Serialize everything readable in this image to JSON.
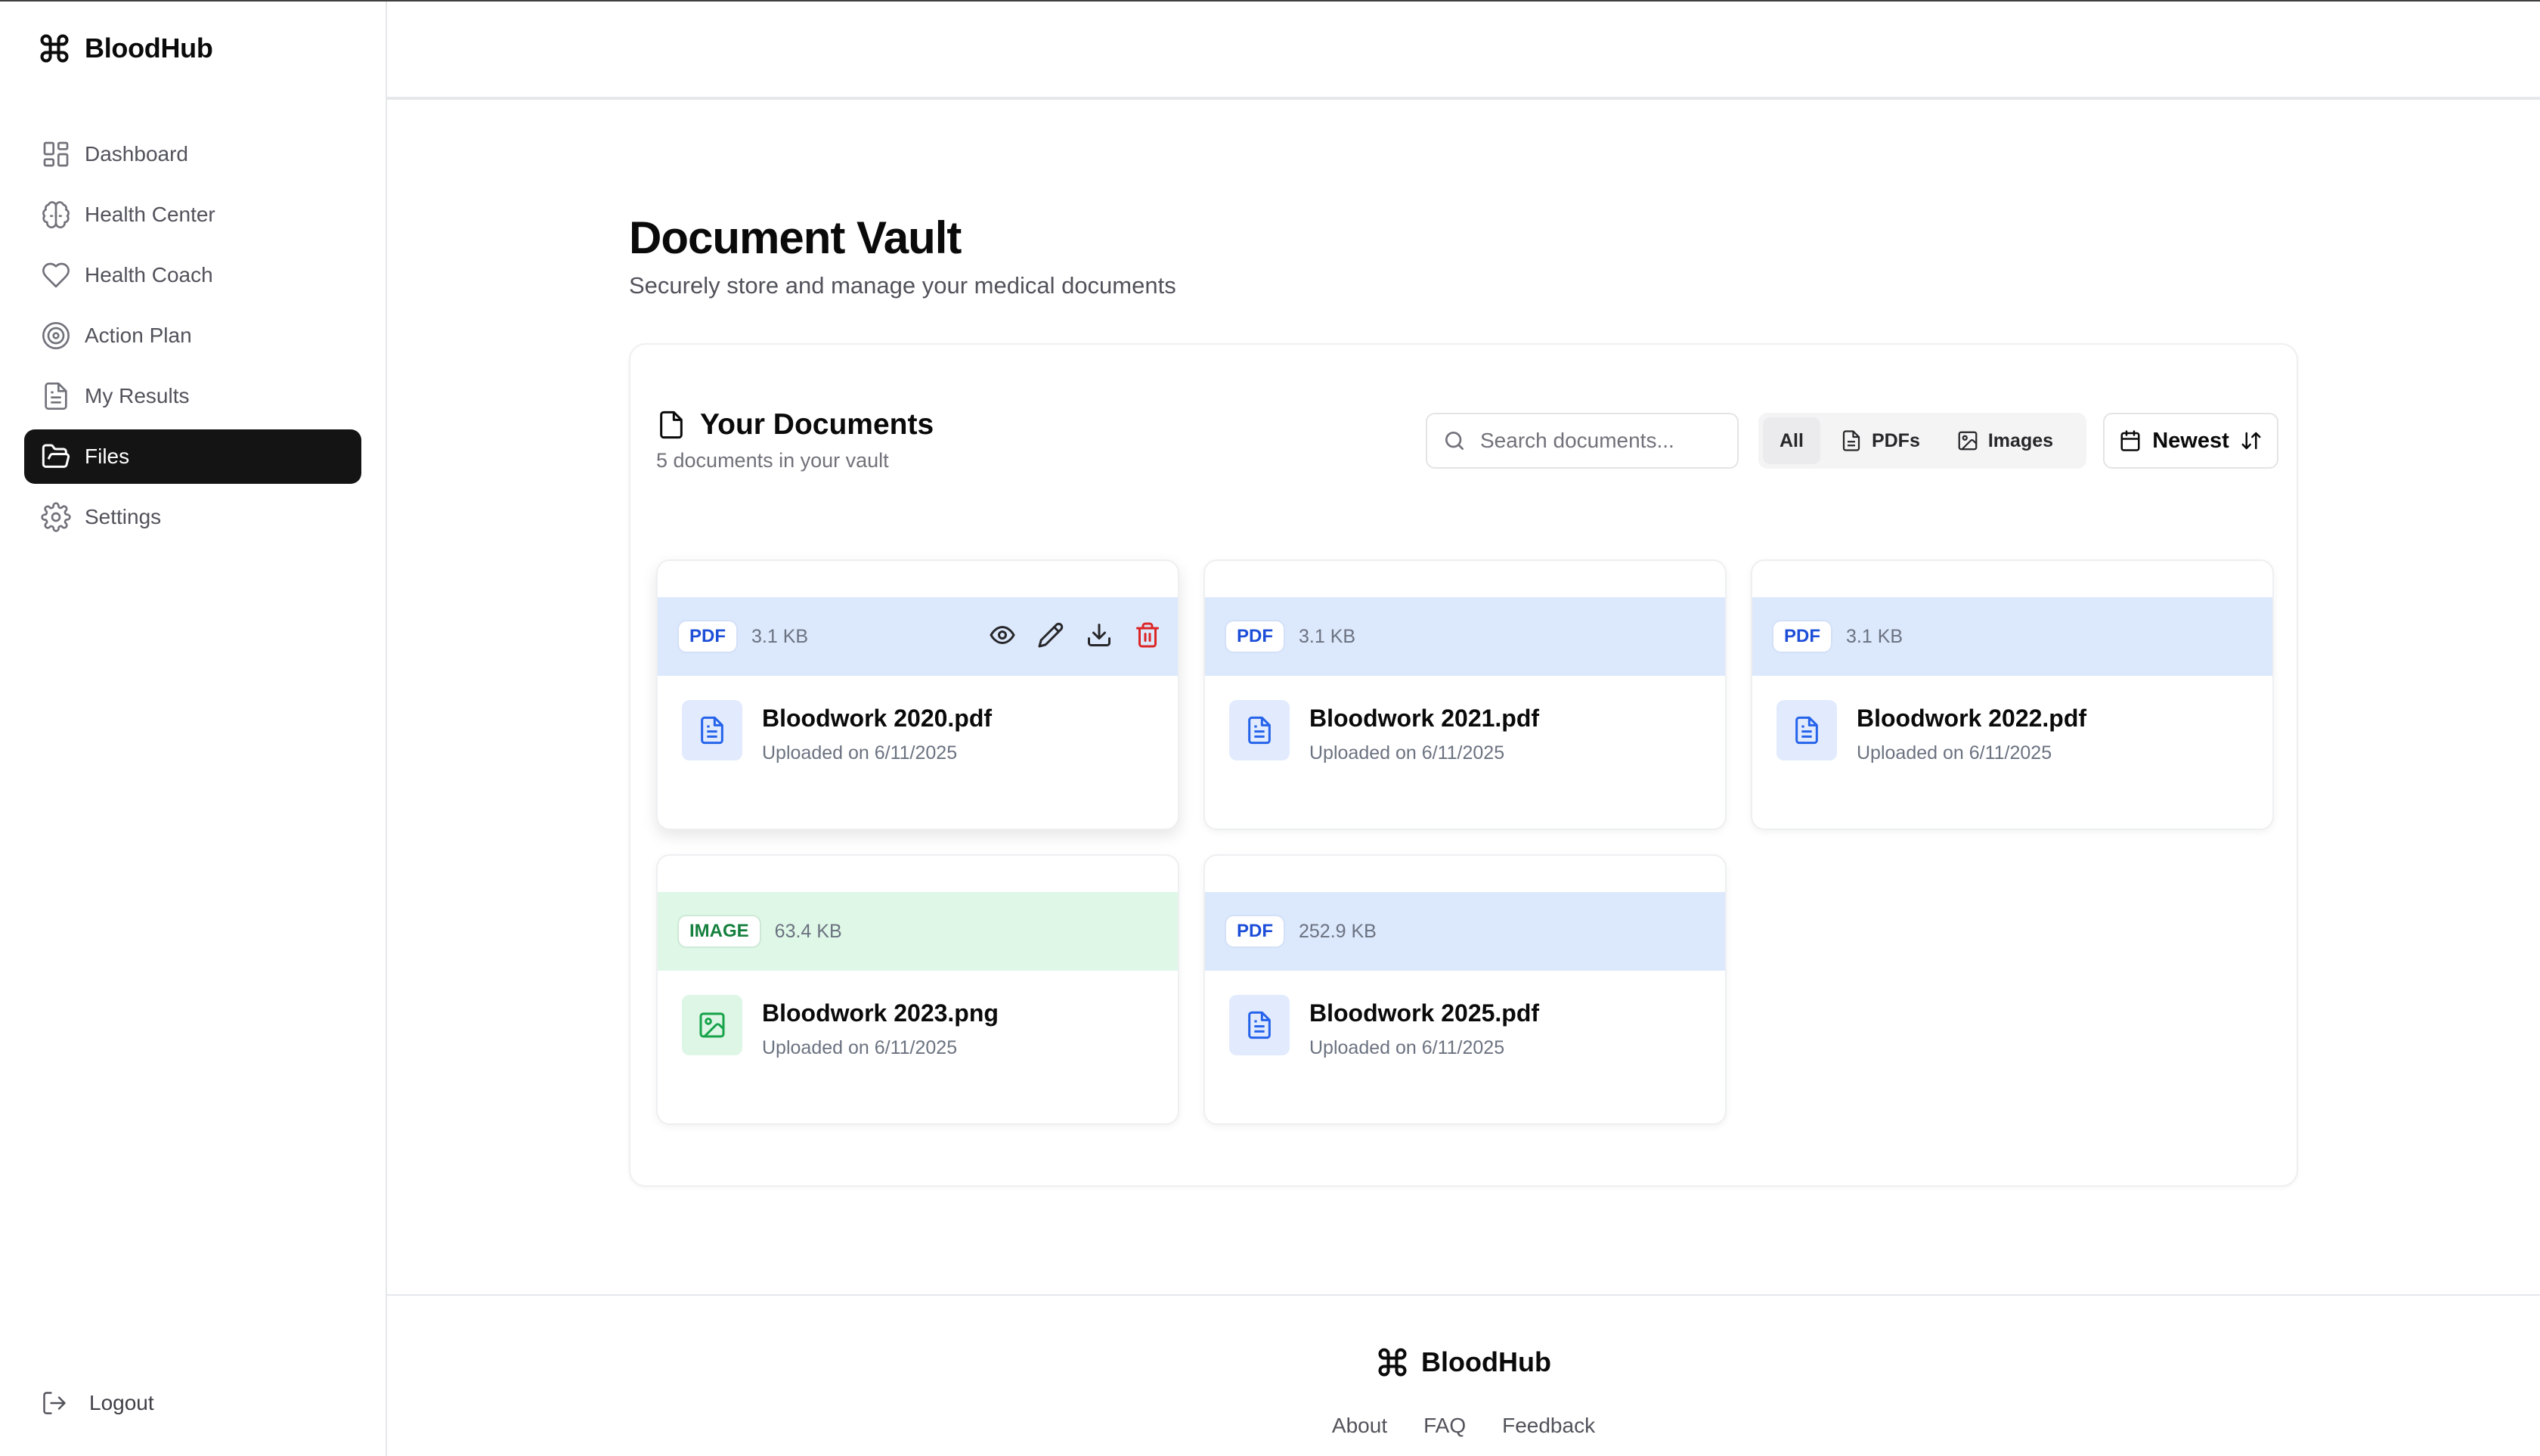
{
  "app": {
    "name": "BloodHub"
  },
  "sidebar": {
    "items": [
      {
        "label": "Dashboard",
        "icon": "dashboard-icon"
      },
      {
        "label": "Health Center",
        "icon": "brain-icon"
      },
      {
        "label": "Health Coach",
        "icon": "heart-icon"
      },
      {
        "label": "Action Plan",
        "icon": "target-icon"
      },
      {
        "label": "My Results",
        "icon": "document-icon"
      },
      {
        "label": "Files",
        "icon": "folder-open-icon",
        "active": true
      },
      {
        "label": "Settings",
        "icon": "gear-icon"
      }
    ],
    "logout_label": "Logout"
  },
  "page": {
    "title": "Document Vault",
    "subtitle": "Securely store and manage your medical documents"
  },
  "documents_panel": {
    "title": "Your Documents",
    "count_text": "5 documents in your vault",
    "search_placeholder": "Search documents...",
    "filters": {
      "all": "All",
      "pdfs": "PDFs",
      "images": "Images"
    },
    "sort_label": "Newest"
  },
  "documents": [
    {
      "type": "PDF",
      "size": "3.1 KB",
      "name": "Bloodwork 2020.pdf",
      "date": "Uploaded on 6/11/2025"
    },
    {
      "type": "PDF",
      "size": "3.1 KB",
      "name": "Bloodwork 2021.pdf",
      "date": "Uploaded on 6/11/2025"
    },
    {
      "type": "PDF",
      "size": "3.1 KB",
      "name": "Bloodwork 2022.pdf",
      "date": "Uploaded on 6/11/2025"
    },
    {
      "type": "IMAGE",
      "size": "63.4 KB",
      "name": "Bloodwork 2023.png",
      "date": "Uploaded on 6/11/2025"
    },
    {
      "type": "PDF",
      "size": "252.9 KB",
      "name": "Bloodwork 2025.pdf",
      "date": "Uploaded on 6/11/2025"
    }
  ],
  "footer": {
    "brand": "BloodHub",
    "links": [
      "About",
      "FAQ",
      "Feedback"
    ]
  },
  "colors": {
    "active_nav": "#141414",
    "pdf_accent": "#2563eb",
    "image_accent": "#16a34a",
    "delete": "#dc2626"
  }
}
